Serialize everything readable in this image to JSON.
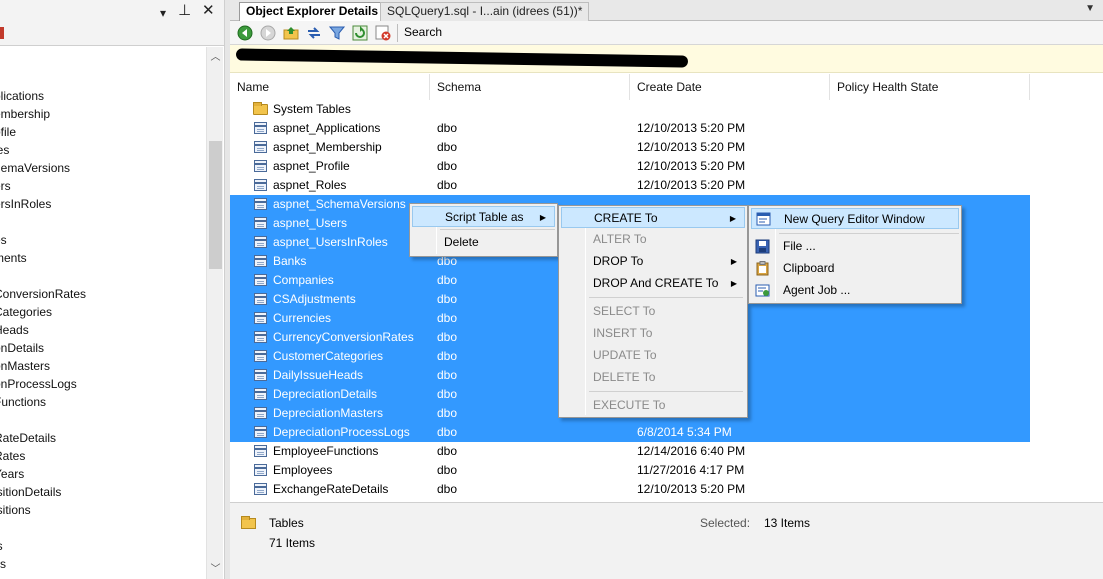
{
  "left_panel": {
    "title_buttons": [
      "▾",
      "⊥",
      "✕"
    ],
    "tree_items": [
      "plications",
      "embership",
      "ofile",
      "les",
      "hemaVersions",
      "ers",
      "ersInRoles",
      "",
      "es",
      "ments",
      "s",
      "ConversionRates",
      "Categories",
      "Heads",
      "onDetails",
      "onMasters",
      "onProcessLogs",
      "Functions",
      "s",
      "RateDetails",
      "Rates",
      "Years",
      "isitionDetails",
      "isitions",
      "",
      "ls",
      "lts"
    ]
  },
  "tabs": {
    "active": "Object Explorer Details",
    "inactive": "SQLQuery1.sql - I...ain (idrees (51))*"
  },
  "toolbar": {
    "search_label": "Search",
    "icons": [
      "back-icon",
      "forward-icon",
      "up-folder-icon",
      "sync-icon",
      "filter-icon",
      "refresh-icon",
      "stop-icon"
    ]
  },
  "grid": {
    "columns": [
      "Name",
      "Schema",
      "Create Date",
      "Policy Health State"
    ],
    "folder_row": "System Tables",
    "rows": [
      {
        "name": "aspnet_Applications",
        "schema": "dbo",
        "date": "12/10/2013 5:20 PM",
        "selected": false
      },
      {
        "name": "aspnet_Membership",
        "schema": "dbo",
        "date": "12/10/2013 5:20 PM",
        "selected": false
      },
      {
        "name": "aspnet_Profile",
        "schema": "dbo",
        "date": "12/10/2013 5:20 PM",
        "selected": false
      },
      {
        "name": "aspnet_Roles",
        "schema": "dbo",
        "date": "12/10/2013 5:20 PM",
        "selected": false
      },
      {
        "name": "aspnet_SchemaVersions",
        "schema": "",
        "date": "",
        "selected": true
      },
      {
        "name": "aspnet_Users",
        "schema": "",
        "date": "",
        "selected": true
      },
      {
        "name": "aspnet_UsersInRoles",
        "schema": "",
        "date": "",
        "selected": true
      },
      {
        "name": "Banks",
        "schema": "dbo",
        "date": "",
        "selected": true
      },
      {
        "name": "Companies",
        "schema": "dbo",
        "date": "",
        "selected": true
      },
      {
        "name": "CSAdjustments",
        "schema": "dbo",
        "date": "",
        "selected": true
      },
      {
        "name": "Currencies",
        "schema": "dbo",
        "date": "",
        "selected": true
      },
      {
        "name": "CurrencyConversionRates",
        "schema": "dbo",
        "date": "",
        "selected": true
      },
      {
        "name": "CustomerCategories",
        "schema": "dbo",
        "date": "",
        "selected": true
      },
      {
        "name": "DailyIssueHeads",
        "schema": "dbo",
        "date": "",
        "selected": true
      },
      {
        "name": "DepreciationDetails",
        "schema": "dbo",
        "date": "",
        "selected": true
      },
      {
        "name": "DepreciationMasters",
        "schema": "dbo",
        "date": "",
        "selected": true
      },
      {
        "name": "DepreciationProcessLogs",
        "schema": "dbo",
        "date": "6/8/2014 5:34 PM",
        "selected": true
      },
      {
        "name": "EmployeeFunctions",
        "schema": "dbo",
        "date": "12/14/2016 6:40 PM",
        "selected": false
      },
      {
        "name": "Employees",
        "schema": "dbo",
        "date": "11/27/2016 4:17 PM",
        "selected": false
      },
      {
        "name": "ExchangeRateDetails",
        "schema": "dbo",
        "date": "12/10/2013 5:20 PM",
        "selected": false
      }
    ]
  },
  "status": {
    "folder_label": "Tables",
    "count_text": "71 Items",
    "selected_label": "Selected:",
    "selected_value": "13 Items"
  },
  "menu1": {
    "items": [
      {
        "label": "Script Table as",
        "submenu": true,
        "highlight": true
      },
      {
        "label": "Delete",
        "submenu": false,
        "highlight": false
      }
    ]
  },
  "menu2": {
    "items": [
      {
        "label": "CREATE To",
        "submenu": true,
        "disabled": false,
        "highlight": true
      },
      {
        "label": "ALTER To",
        "submenu": false,
        "disabled": true,
        "highlight": false
      },
      {
        "label": "DROP To",
        "submenu": true,
        "disabled": false,
        "highlight": false
      },
      {
        "label": "DROP And CREATE To",
        "submenu": true,
        "disabled": false,
        "highlight": false
      },
      {
        "label": "SELECT To",
        "submenu": false,
        "disabled": true,
        "highlight": false
      },
      {
        "label": "INSERT To",
        "submenu": false,
        "disabled": true,
        "highlight": false
      },
      {
        "label": "UPDATE To",
        "submenu": false,
        "disabled": true,
        "highlight": false
      },
      {
        "label": "DELETE To",
        "submenu": false,
        "disabled": true,
        "highlight": false
      },
      {
        "label": "EXECUTE To",
        "submenu": false,
        "disabled": true,
        "highlight": false
      }
    ]
  },
  "menu3": {
    "items": [
      {
        "label": "New Query Editor Window",
        "icon": "query-window-icon",
        "highlight": true
      },
      {
        "label": "File ...",
        "icon": "save-file-icon",
        "highlight": false
      },
      {
        "label": "Clipboard",
        "icon": "clipboard-icon",
        "highlight": false
      },
      {
        "label": "Agent Job ...",
        "icon": "agent-job-icon",
        "highlight": false
      }
    ]
  },
  "colors": {
    "selection": "#3399ff",
    "menu_highlight": "#cce8ff",
    "path_bar": "#fffbe0"
  }
}
